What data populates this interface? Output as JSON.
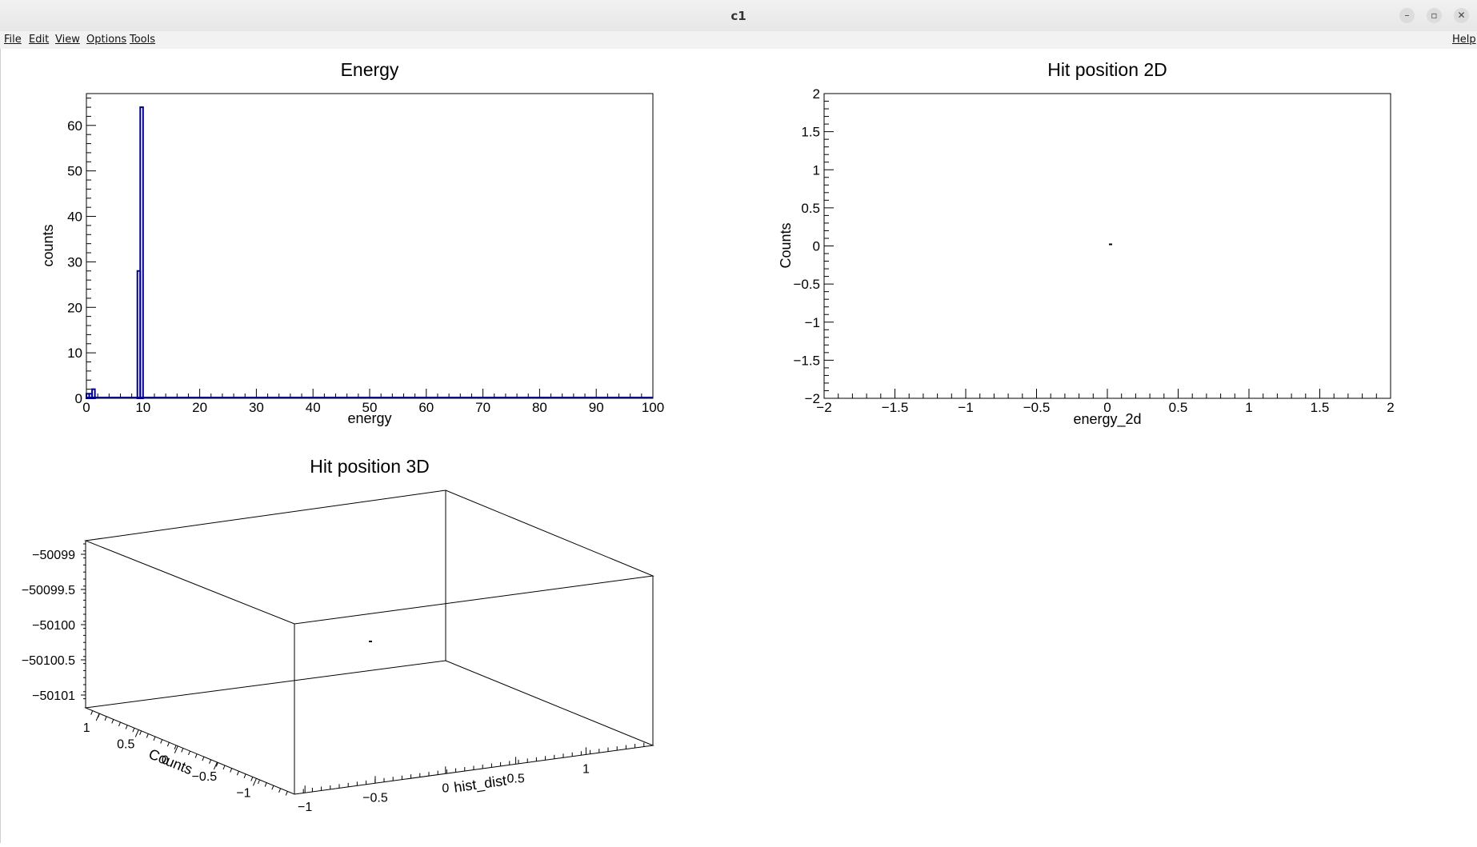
{
  "window": {
    "title": "c1"
  },
  "window_controls": [
    "–",
    "▫",
    "✕"
  ],
  "menu": {
    "file": "File",
    "edit": "Edit",
    "view": "View",
    "options": "Options",
    "tools": "Tools",
    "help": "Help"
  },
  "chart_data": [
    {
      "type": "bar",
      "title": "Energy",
      "xlabel": "energy",
      "ylabel": "counts",
      "xlim": [
        0,
        100
      ],
      "ylim": [
        0,
        67
      ],
      "x_ticks": [
        "0",
        "10",
        "20",
        "30",
        "40",
        "50",
        "60",
        "70",
        "80",
        "90",
        "100"
      ],
      "y_ticks": [
        "0",
        "10",
        "20",
        "30",
        "40",
        "50",
        "60"
      ],
      "line_color": "#00008b",
      "bins": [
        {
          "x0": 0.0,
          "x1": 0.5,
          "value": 1
        },
        {
          "x0": 0.5,
          "x1": 1.0,
          "value": 1
        },
        {
          "x0": 1.0,
          "x1": 1.5,
          "value": 2
        },
        {
          "x0": 9.0,
          "x1": 9.5,
          "value": 28
        },
        {
          "x0": 9.5,
          "x1": 10.0,
          "value": 64
        }
      ]
    },
    {
      "type": "scatter",
      "title": "Hit position 2D",
      "xlabel": "energy_2d",
      "ylabel": "Counts",
      "xlim": [
        -2,
        2
      ],
      "ylim": [
        -2,
        2
      ],
      "x_ticks": [
        "−2",
        "−1.5",
        "−1",
        "−0.5",
        "0",
        "0.5",
        "1",
        "1.5",
        "2"
      ],
      "y_ticks": [
        "−2",
        "−1.5",
        "−1",
        "−0.5",
        "0",
        "0.5",
        "1",
        "1.5",
        "2"
      ],
      "points": [
        {
          "x": 0,
          "y": 0
        }
      ]
    },
    {
      "type": "scatter",
      "title": "Hit position 3D",
      "xlabel": "hist_dist",
      "ylabel": "Counts",
      "x_ticks": [
        "−1",
        "−0.5",
        "0",
        "0.5",
        "1"
      ],
      "y_ticks": [
        "1",
        "0.5",
        "0",
        "−0.5",
        "−1"
      ],
      "z_ticks": [
        "−50099",
        "−50099.5",
        "−50100",
        "−50100.5",
        "−50101"
      ],
      "points": [
        {
          "x": 0,
          "y": 0,
          "z": -50100
        }
      ]
    }
  ]
}
